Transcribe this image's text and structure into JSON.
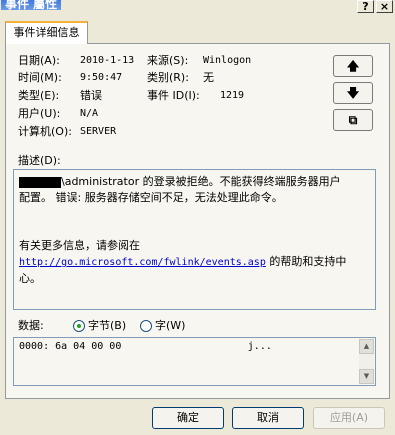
{
  "window": {
    "title": "事件 屬性",
    "help_glyph": "?",
    "close_glyph": "×"
  },
  "tab": {
    "label": "事件详细信息"
  },
  "fields": {
    "date": {
      "label": "日期(A):",
      "value": "2010-1-13"
    },
    "time": {
      "label": "时间(M):",
      "value": "9:50:47"
    },
    "type": {
      "label": "类型(E):",
      "value": "错误"
    },
    "user": {
      "label": "用户(U):",
      "value": "N/A"
    },
    "computer": {
      "label": "计算机(O):",
      "value": "SERVER"
    },
    "source": {
      "label": "来源(S):",
      "value": "Winlogon"
    },
    "category": {
      "label": "类别(R):",
      "value": "无"
    },
    "event_id": {
      "label": "事件 ID(I):",
      "value": "1219"
    }
  },
  "nav": {
    "up_icon": "arrow-up-icon",
    "down_icon": "arrow-down-icon",
    "copy_icon": "copy-icon"
  },
  "description": {
    "label": "描述(D):",
    "line1": "\\administrator 的登录被拒绝。不能获得终端服务器用户",
    "line2": "配置。 错误: 服务器存储空间不足，无法处理此命令。",
    "more_info": "有关更多信息，请参阅在",
    "link": "http://go.microsoft.com/fwlink/events.asp",
    "link_suffix": " 的帮助和支持中",
    "line_end": "心。"
  },
  "data_section": {
    "label": "数据:",
    "radio_bytes": "字节(B)",
    "radio_words": "字(W)",
    "selected": "bytes",
    "content": "0000: 6a 04 00 00                     j..."
  },
  "buttons": {
    "ok": "确定",
    "cancel": "取消",
    "apply": "应用(A)"
  }
}
